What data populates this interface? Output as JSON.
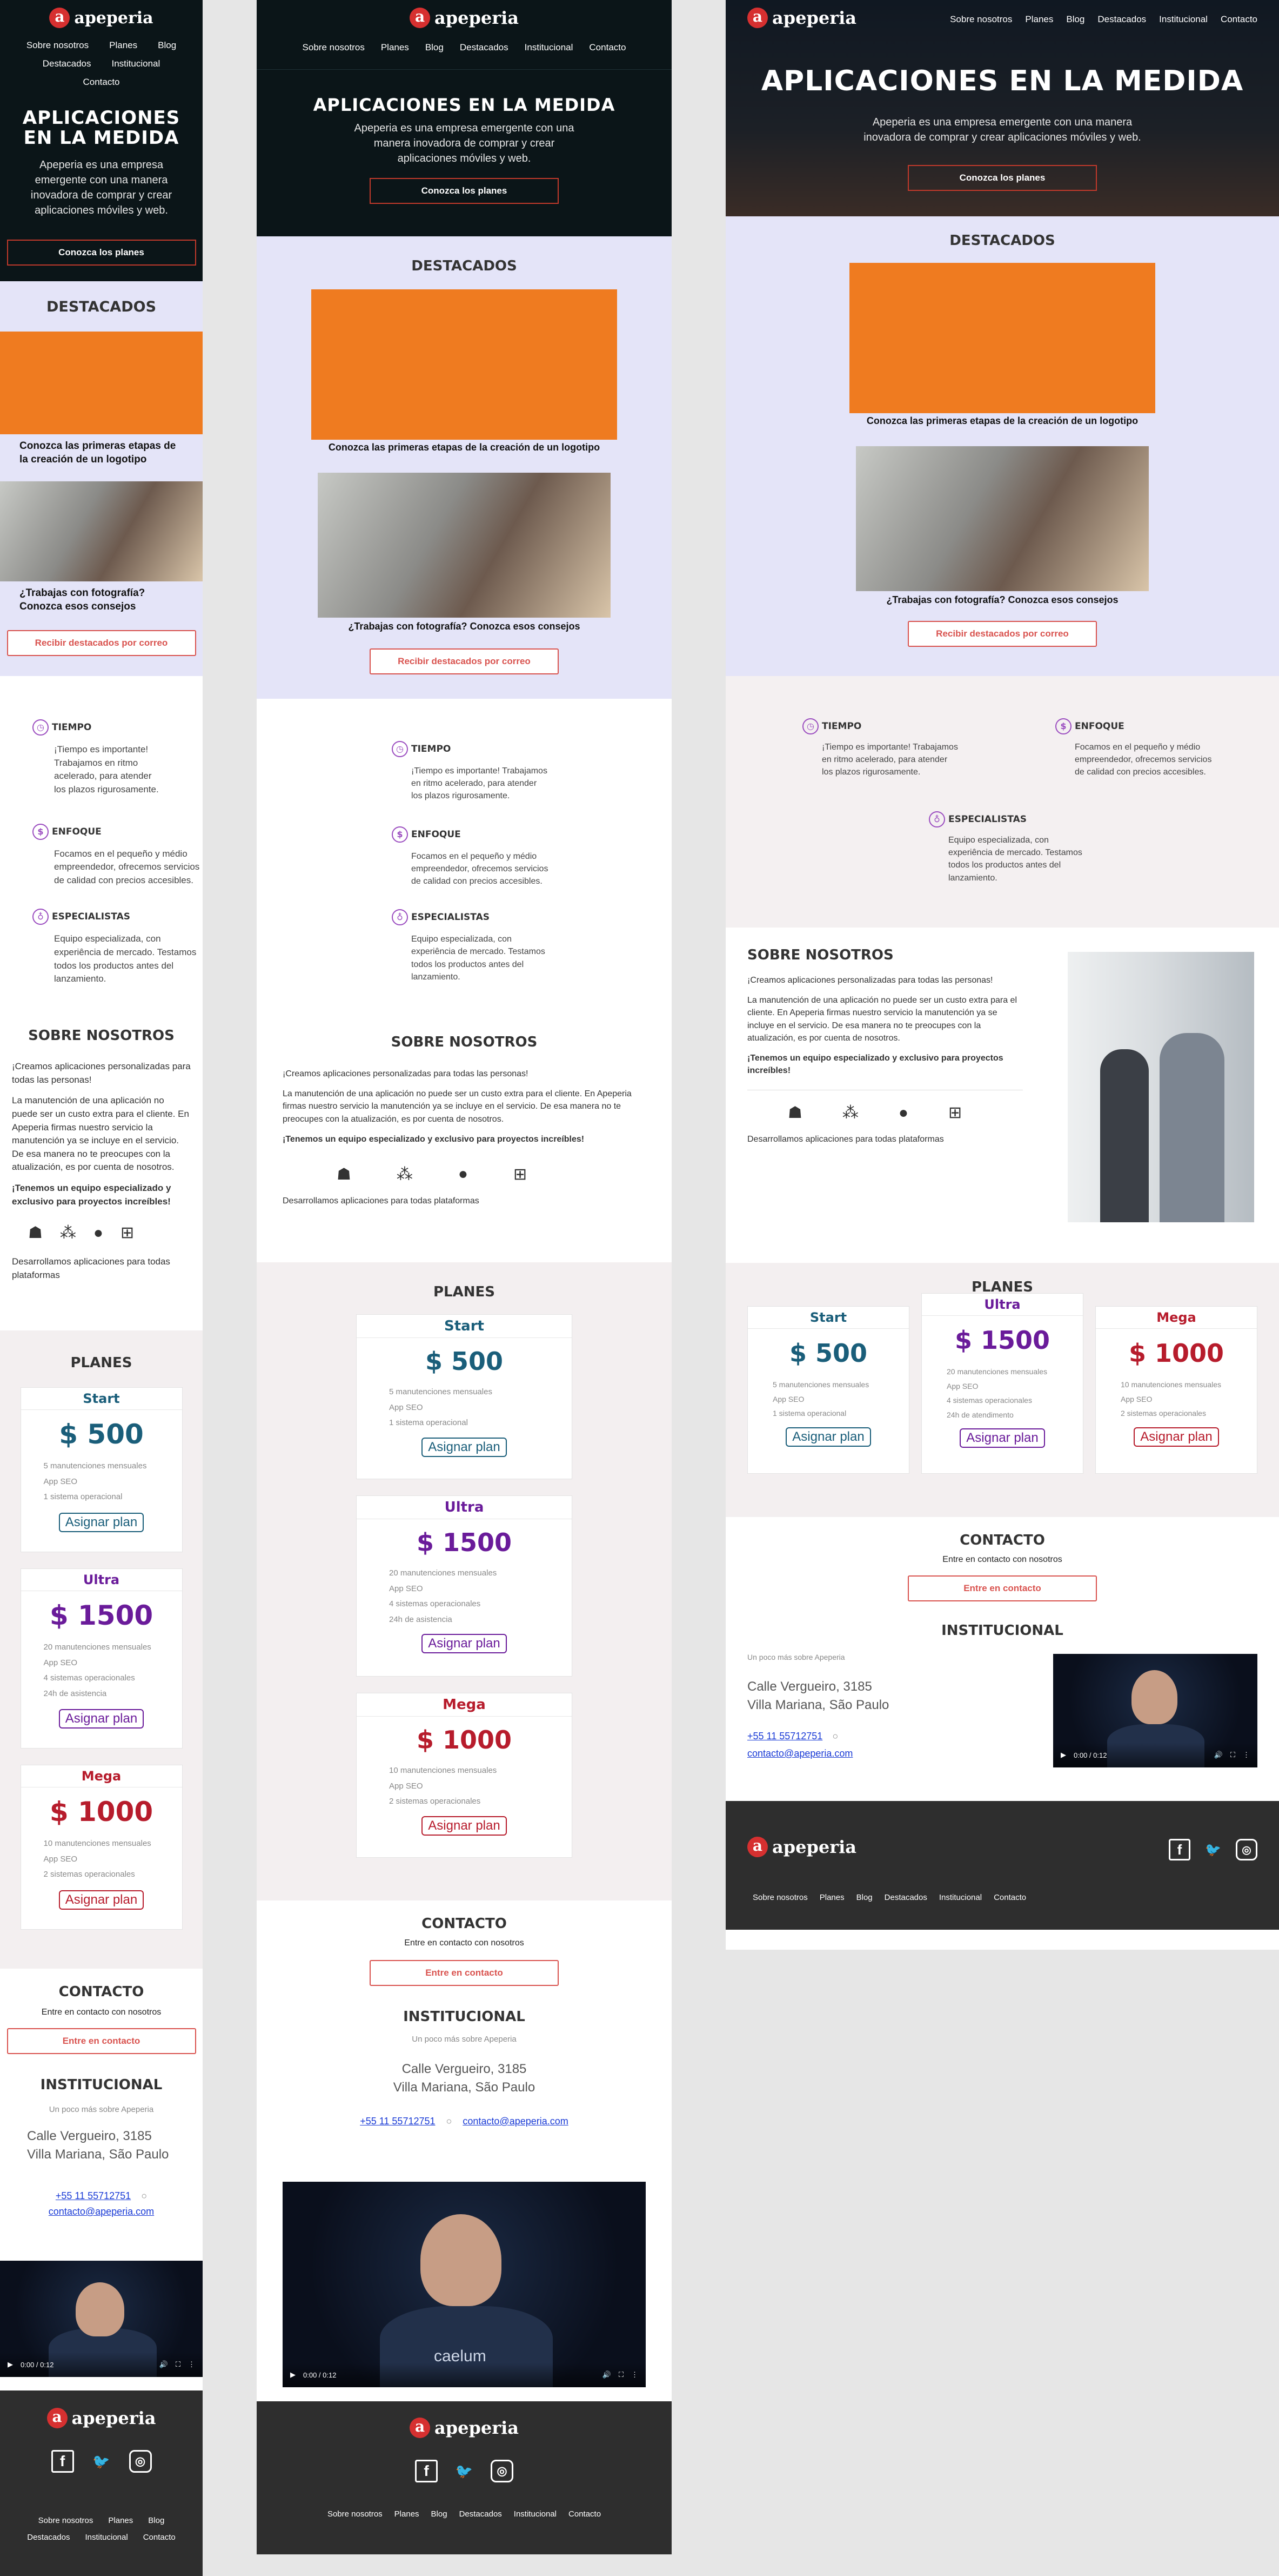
{
  "brand": {
    "name": "apeperia",
    "logo_letter": "a",
    "accent": "#d63030"
  },
  "nav": [
    "Sobre nosotros",
    "Planes",
    "Blog",
    "Destacados",
    "Institucional",
    "Contacto"
  ],
  "hero": {
    "title": "APLICACIONES EN LA MEDIDA",
    "title_mobile_1": "APLICACIONES",
    "title_mobile_2": "EN LA MEDIDA",
    "text": "Apeperia es una empresa emergente con una manera inovadora de comprar y crear aplicaciones móviles y web.",
    "cta": "Conozca los planes"
  },
  "destacados": {
    "title": "DESTACADOS",
    "items": [
      "Conozca las primeras etapas de la creación de un logotipo",
      "¿Trabajas con fotografía? Conozca esos consejos"
    ],
    "cta": "Recibir destacados por correo"
  },
  "features": [
    {
      "icon": "stopwatch-icon",
      "glyph": "◷",
      "title": "TIEMPO",
      "text": "¡Tiempo es importante! Trabajamos en ritmo acelerado, para atender los plazos rigurosamente."
    },
    {
      "icon": "target-icon",
      "glyph": "$",
      "title": "ENFOQUE",
      "text": "Focamos en el pequeño y médio empreendedor, ofrecemos servicios de calidad con precios accesibles."
    },
    {
      "icon": "flask-icon",
      "glyph": "♁",
      "title": "ESPECIALISTAS",
      "text": "Equipo especializada, con experiência de mercado. Testamos todos los productos antes del lanzamiento."
    }
  ],
  "about": {
    "title": "SOBRE NOSOTROS",
    "p1": "¡Creamos aplicaciones personalizadas para todas las personas!",
    "p2": "La manutención de una aplicación no puede ser un custo extra para el cliente. En Apeperia firmas nuestro servicio la manutención ya se incluye en el servicio. De esa manera no te preocupes con la atualización, es por cuenta de nosotros.",
    "p3": "¡Tenemos un equipo especializado y exclusivo para proyectos increíbles!",
    "platforms": [
      "android-icon",
      "blackberry-icon",
      "apple-icon",
      "windows-icon"
    ],
    "platforms_text": "Desarrollamos aplicaciones para todas plataformas"
  },
  "plans": {
    "title": "PLANES",
    "items": [
      {
        "name": "Start",
        "price": "$ 500",
        "features": [
          "5 manutenciones mensuales",
          "App SEO",
          "1 sistema operacional"
        ],
        "cta": "Asignar plan",
        "color": "#1a5e7a"
      },
      {
        "name": "Ultra",
        "price": "$ 1500",
        "features": [
          "20 manutenciones mensuales",
          "App SEO",
          "4 sistemas operacionales",
          "24h de asistencia"
        ],
        "features_desktop_last": "24h de atendimento",
        "cta": "Asignar plan",
        "color": "#6a1b9a"
      },
      {
        "name": "Mega",
        "price": "$ 1000",
        "features": [
          "10 manutenciones mensuales",
          "App SEO",
          "2 sistemas operacionales"
        ],
        "cta": "Asignar plan",
        "color": "#b71c2c"
      }
    ]
  },
  "contact": {
    "title": "CONTACTO",
    "sub": "Entre en contacto con nosotros",
    "cta": "Entre en contacto"
  },
  "institucional": {
    "title": "INSTITUCIONAL",
    "sub": "Un poco más sobre Apeperia",
    "addr1": "Calle Vergueiro, 3185",
    "addr2": "Villa Mariana, São Paulo",
    "phone": "+55 11 55712751",
    "sep": "○",
    "email": "contacto@apeperia.com"
  },
  "video": {
    "time": "0:00 / 0:12",
    "watermark": "caelum"
  },
  "social": [
    "facebook-icon",
    "twitter-icon",
    "instagram-icon"
  ]
}
